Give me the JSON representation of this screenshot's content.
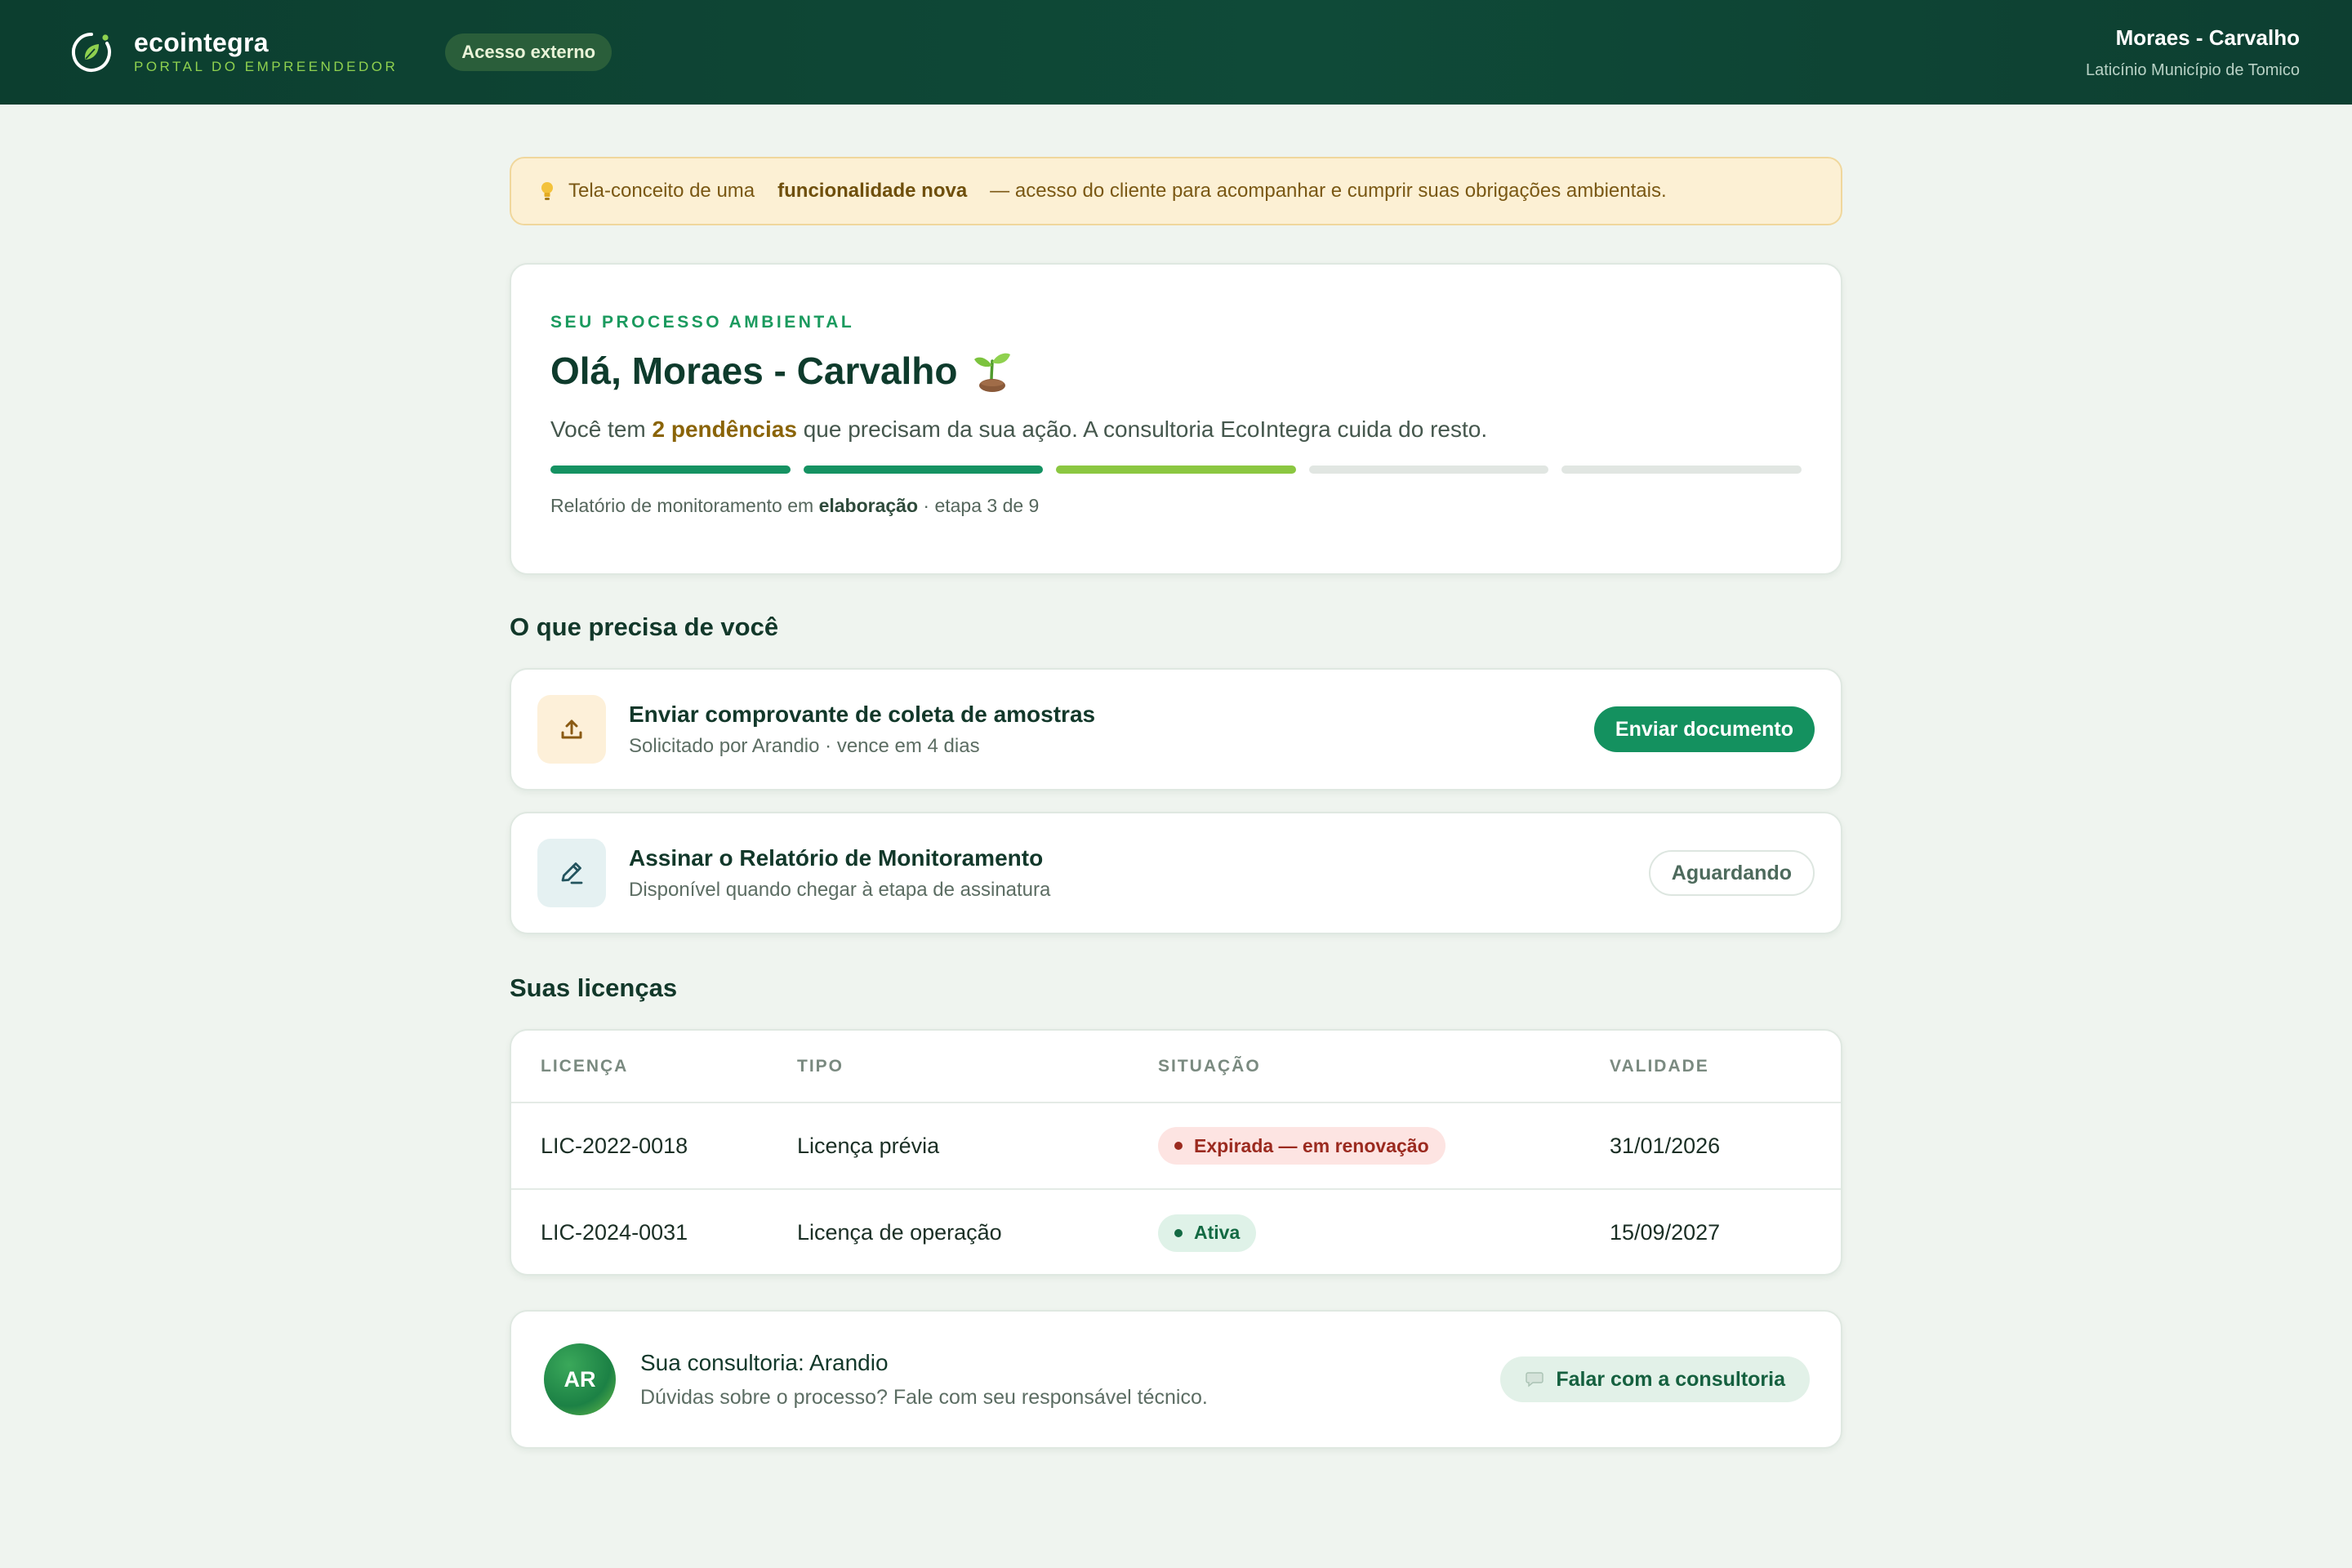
{
  "header": {
    "brand_name": "ecointegra",
    "brand_subtitle": "PORTAL DO EMPREENDEDOR",
    "access_badge": "Acesso externo",
    "user_name": "Moraes - Carvalho",
    "user_org": "Laticínio Município de Tomico"
  },
  "notice": {
    "icon": "lightbulb-icon",
    "text_before": "Tela-conceito de uma",
    "text_bold": "funcionalidade nova",
    "text_after": "— acesso do cliente para acompanhar e cumprir suas obrigações ambientais."
  },
  "process": {
    "kicker": "SEU PROCESSO AMBIENTAL",
    "greeting": "Olá, Moraes - Carvalho",
    "lead_before": "Você tem",
    "lead_highlight": "2 pendências",
    "lead_after": "que precisam da sua ação. A consultoria EcoIntegra cuida do resto.",
    "steps_state": [
      "done",
      "done",
      "current",
      "pending",
      "pending"
    ],
    "caption_before": "Relatório de monitoramento em",
    "caption_bold": "elaboração",
    "caption_after": "· etapa 3 de 9"
  },
  "todo": {
    "title": "O que precisa de você",
    "tasks": [
      {
        "title": "Enviar comprovante de coleta de amostras",
        "subtitle": "Solicitado por Arandio · vence em 4 dias",
        "action": "Enviar documento",
        "icon": "upload-icon"
      },
      {
        "title": "Assinar o Relatório de Monitoramento",
        "subtitle": "Disponível quando chegar à etapa de assinatura",
        "action": "Aguardando",
        "icon": "pen-icon"
      }
    ]
  },
  "licenses": {
    "title": "Suas licenças",
    "columns": [
      "LICENÇA",
      "TIPO",
      "SITUAÇÃO",
      "VALIDADE"
    ],
    "rows": [
      {
        "id": "LIC-2022-0018",
        "type": "Licença prévia",
        "status": "Expirada — em renovação",
        "validity": "31/01/2026"
      },
      {
        "id": "LIC-2024-0031",
        "type": "Licença de operação",
        "status": "Ativa",
        "validity": "15/09/2027"
      }
    ]
  },
  "consult": {
    "initials": "AR",
    "title": "Sua consultoria: Arandio",
    "subtitle": "Dúvidas sobre o processo? Fale com seu responsável técnico.",
    "action": "Falar com a consultoria",
    "icon": "chat-icon"
  },
  "colors": {
    "header_bg": "#0c3e2f",
    "accent_green": "#14915f",
    "brand_lime": "#8fd14f",
    "notice_bg": "#fcf0d4",
    "expired": "#9b2a1f",
    "active": "#136a43"
  }
}
